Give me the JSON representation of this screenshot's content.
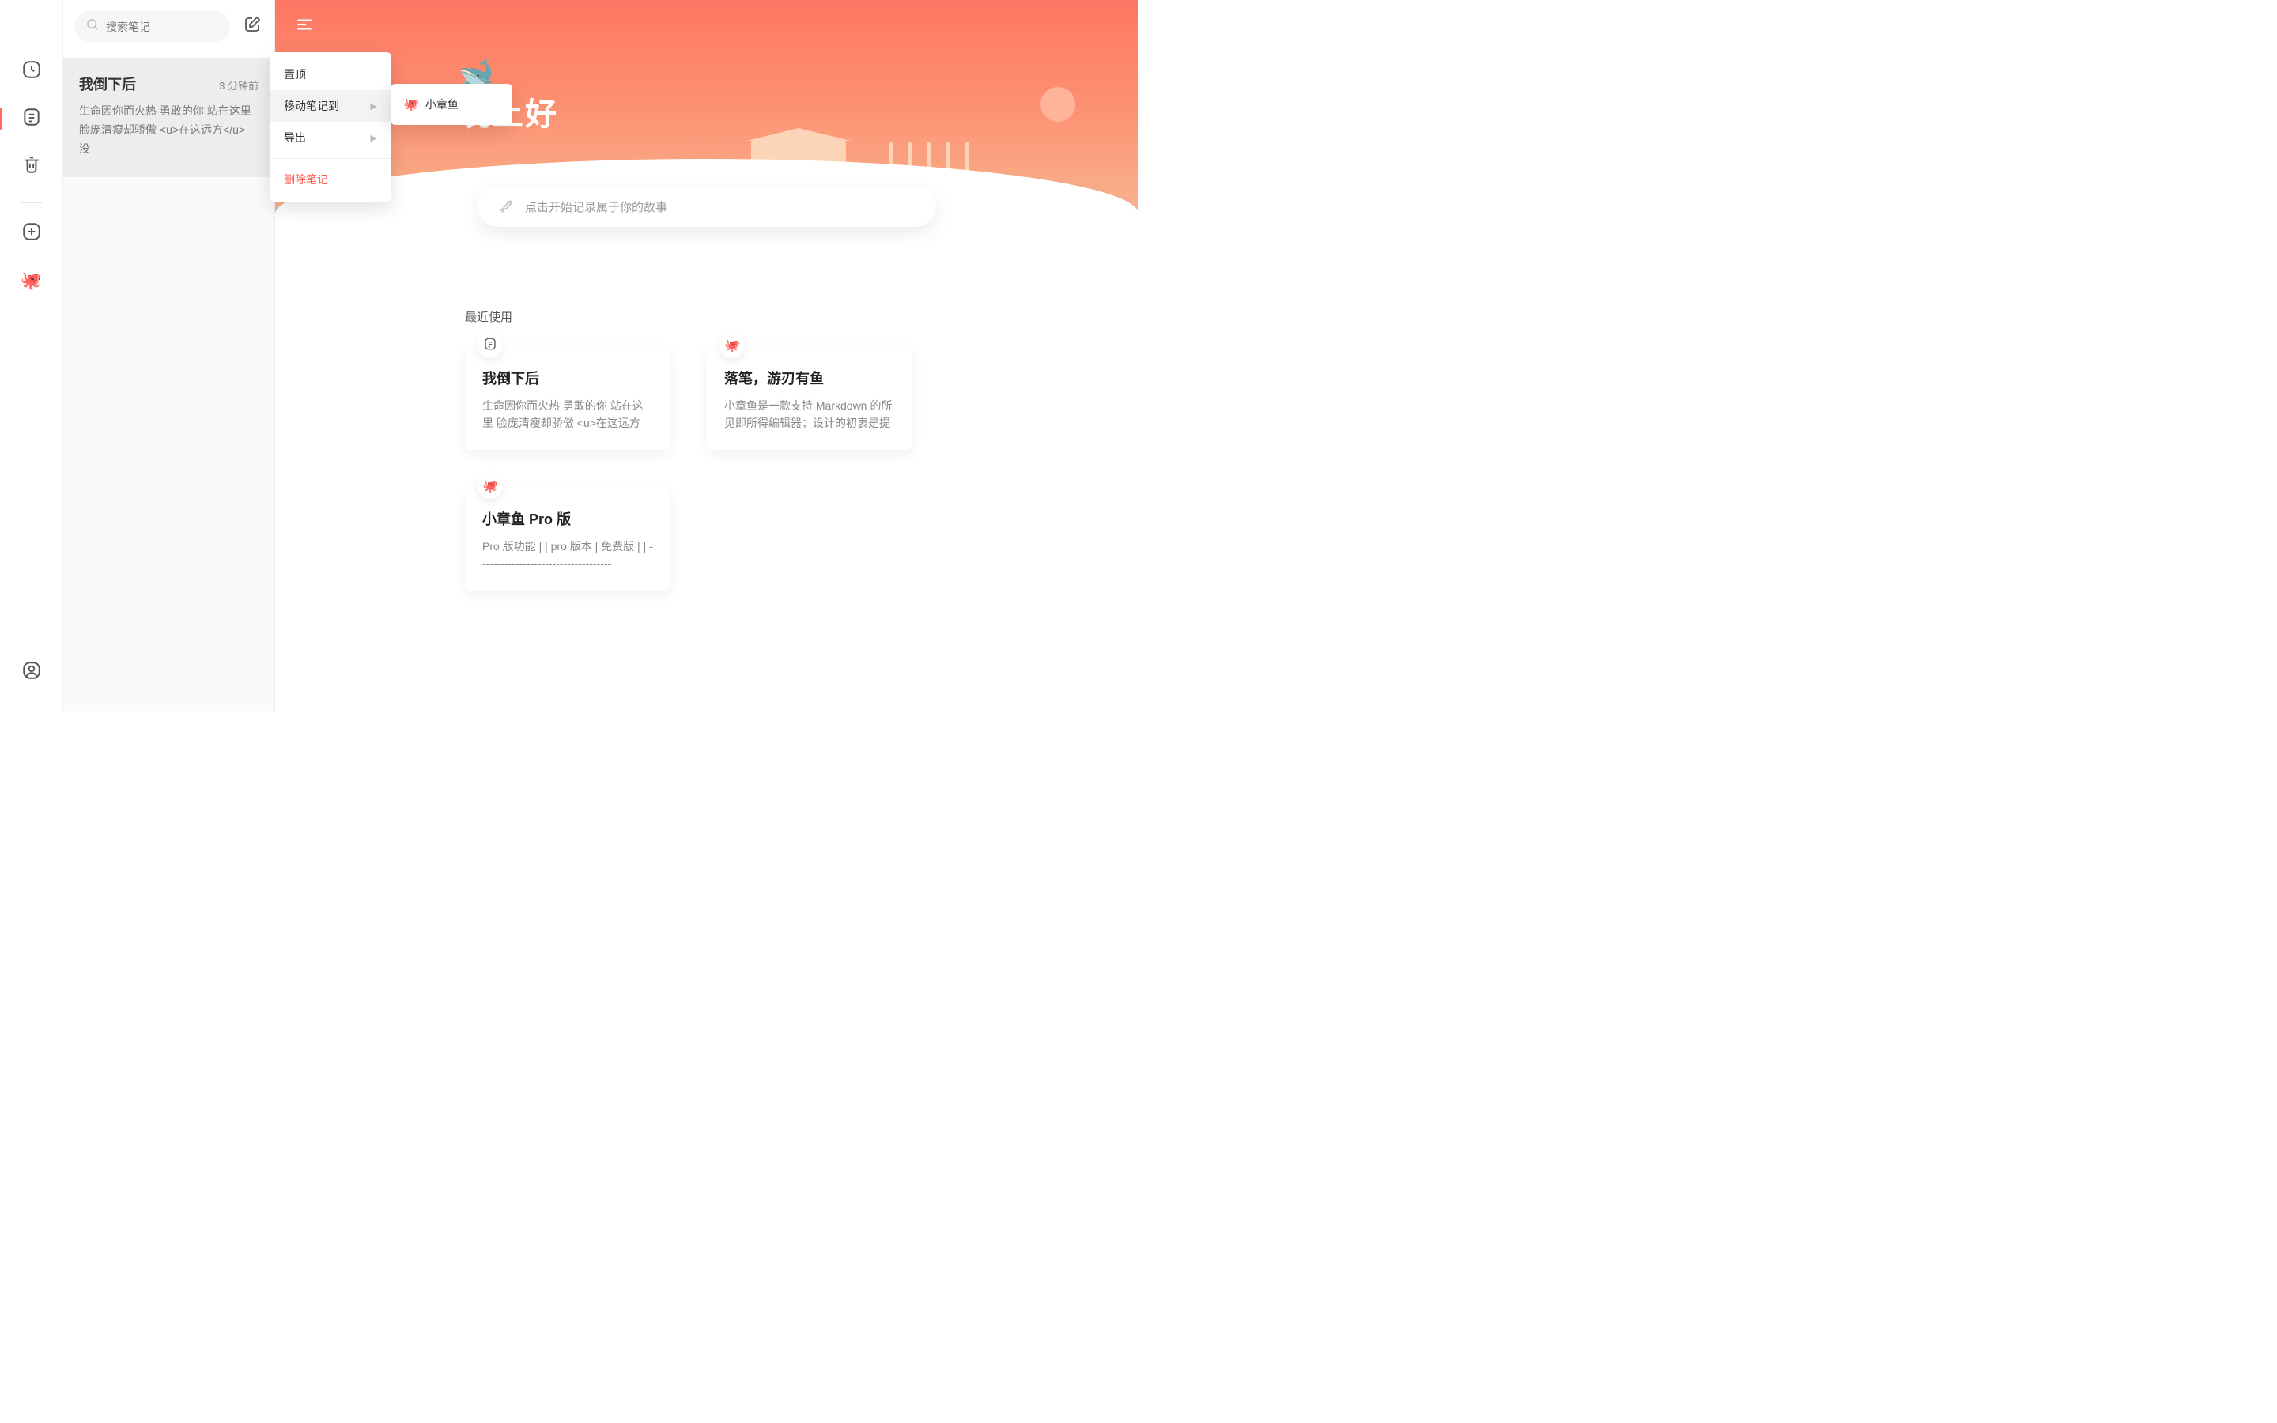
{
  "search": {
    "placeholder": "搜索笔记"
  },
  "sidebar": {
    "items": [
      {
        "id": "recent",
        "name": "clock-icon"
      },
      {
        "id": "notes",
        "name": "note-icon",
        "active": true
      },
      {
        "id": "trash",
        "name": "trash-icon"
      },
      {
        "id": "add",
        "name": "add-icon"
      },
      {
        "id": "octopus",
        "name": "octopus-icon"
      }
    ]
  },
  "note_list": [
    {
      "title": "我倒下后",
      "time": "3 分钟前",
      "preview": "生命因你而火热 勇敢的你 站在这里 脸庞清瘦却骄傲 <u>在这远方</u> 没",
      "selected": true
    }
  ],
  "context_menu": {
    "items": [
      {
        "label": "置顶",
        "id": "pin"
      },
      {
        "label": "移动笔记到",
        "id": "move",
        "arrow": true,
        "hover": true
      },
      {
        "label": "导出",
        "id": "export",
        "arrow": true
      },
      {
        "sep": true
      },
      {
        "label": "删除笔记",
        "id": "delete",
        "danger": true
      }
    ],
    "submenu": {
      "items": [
        {
          "icon": "🐙",
          "label": "小章鱼"
        }
      ]
    }
  },
  "hero": {
    "greeting": "晚上好",
    "whale": "🐋"
  },
  "prompt": {
    "placeholder": "点击开始记录属于你的故事"
  },
  "recent": {
    "title": "最近使用",
    "cards": [
      {
        "badge": "note",
        "title": "我倒下后",
        "excerpt": "生命因你而火热 勇敢的你 站在这里 脸庞清瘦却骄傲 <u>在这远方</u> 没人"
      },
      {
        "badge": "octopus",
        "title": "落笔，游刃有鱼",
        "excerpt": "小章鱼是一款支持 Markdown 的所见即所得编辑器；设计的初衷是提供一个"
      },
      {
        "badge": "octopus",
        "title": "小章鱼 Pro 版",
        "excerpt": "Pro 版功能 | | pro 版本 | 免费版 | | ------------------------------------"
      }
    ]
  },
  "colors": {
    "accent": "#fd6a5e",
    "danger": "#fd5a4e"
  }
}
